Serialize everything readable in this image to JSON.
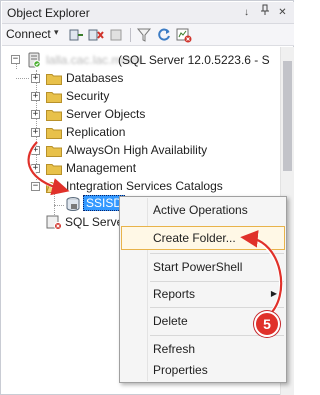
{
  "window": {
    "title": "Object Explorer",
    "pin_glyph": "↓",
    "pushpin_glyph": "↕",
    "close_glyph": "✕"
  },
  "toolbar": {
    "connect_label": "Connect",
    "connect_caret": "▾",
    "icons": [
      "connect-object-explorer-icon",
      "disconnect-icon",
      "stop-icon",
      "filter-icon",
      "refresh-icon",
      "activity-monitor-icon"
    ]
  },
  "tree": {
    "server_label": "(SQL Server 12.0.5223.6 - S",
    "server_name_blurred": "lalla.cac.lac.mmm",
    "items": [
      {
        "label": "Databases",
        "expander": "+"
      },
      {
        "label": "Security",
        "expander": "+"
      },
      {
        "label": "Server Objects",
        "expander": "+"
      },
      {
        "label": "Replication",
        "expander": "+"
      },
      {
        "label": "AlwaysOn High Availability",
        "expander": "+"
      },
      {
        "label": "Management",
        "expander": "+"
      },
      {
        "label": "Integration Services Catalogs",
        "expander": "−"
      }
    ],
    "ssisdb_label": "SSISD",
    "agent_label": "SQL Serve"
  },
  "context_menu": {
    "items": [
      {
        "label": "Active Operations"
      },
      {
        "label": "Create Folder..."
      },
      {
        "label": "Start PowerShell"
      },
      {
        "label": "Reports",
        "has_submenu": true
      },
      {
        "label": "Delete"
      },
      {
        "label": "Refresh"
      },
      {
        "label": "Properties"
      }
    ],
    "submenu_glyph": "▶"
  },
  "annotation": {
    "step_number": "5",
    "color": "#e0312a"
  },
  "colors": {
    "folder": "#e8c14a",
    "selection": "#3399ff",
    "menu_highlight_border": "#e8b34a"
  }
}
